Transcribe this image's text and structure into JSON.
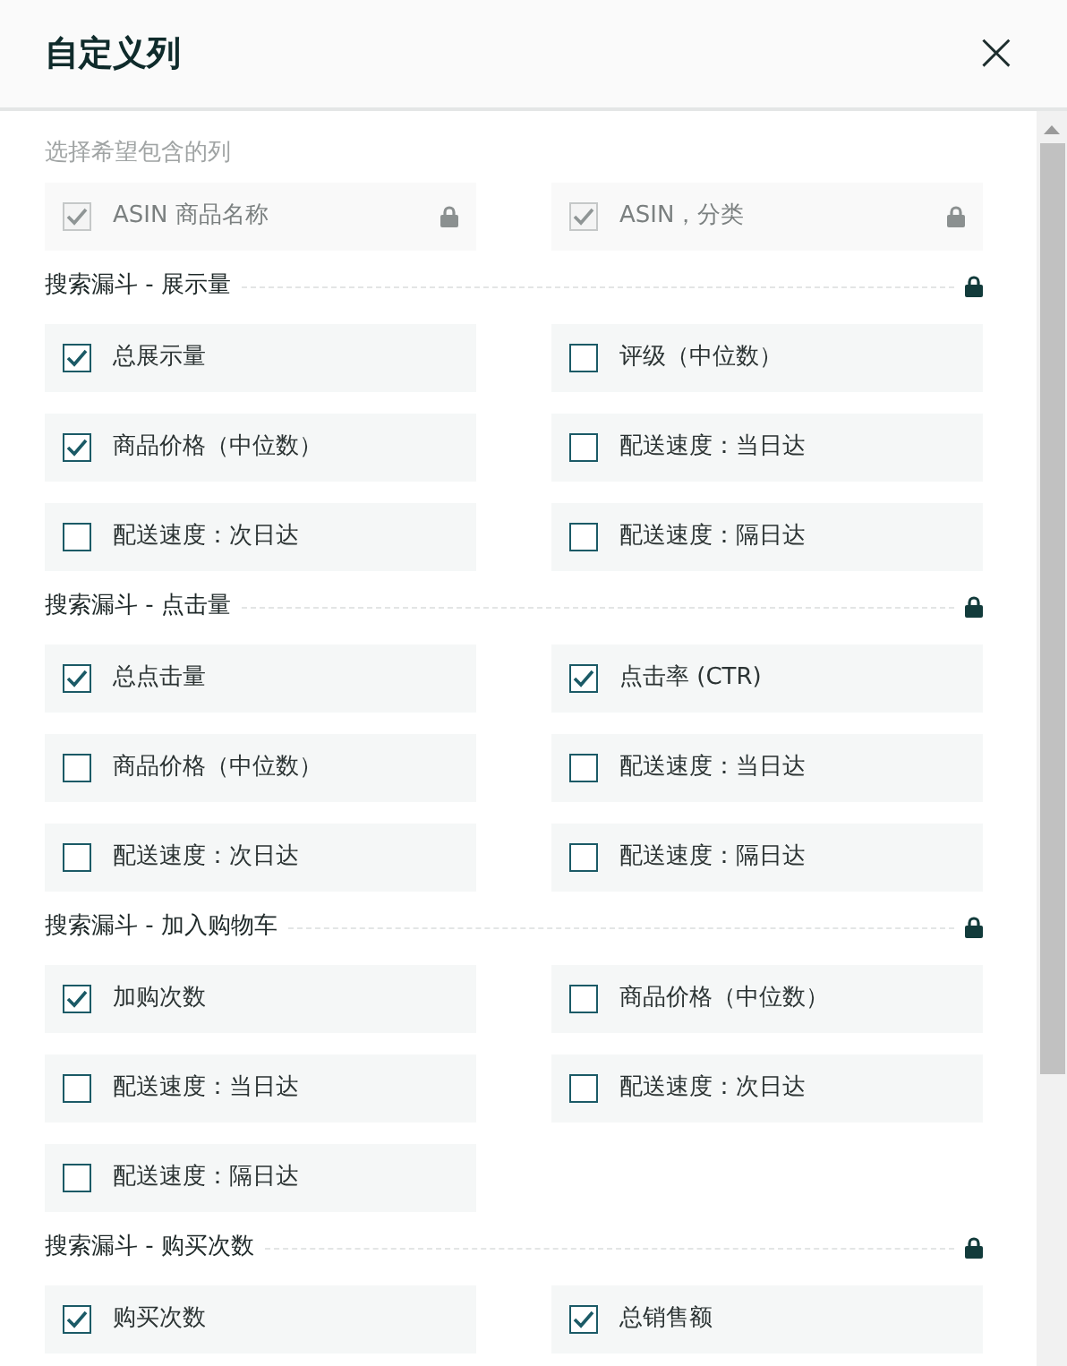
{
  "dialog": {
    "title": "自定义列",
    "close_label": "×"
  },
  "subtitle": "选择希望包含的列",
  "fixed_columns": [
    {
      "label": "ASIN 商品名称",
      "checked": true,
      "disabled": true,
      "locked": true
    },
    {
      "label": "ASIN，分类",
      "checked": true,
      "disabled": true,
      "locked": true
    }
  ],
  "sections": [
    {
      "title": "搜索漏斗 - 展示量",
      "locked": true,
      "options": [
        {
          "label": "总展示量",
          "checked": true
        },
        {
          "label": "评级（中位数）",
          "checked": false
        },
        {
          "label": "商品价格（中位数）",
          "checked": true
        },
        {
          "label": "配送速度：当日达",
          "checked": false
        },
        {
          "label": "配送速度：次日达",
          "checked": false
        },
        {
          "label": "配送速度：隔日达",
          "checked": false
        }
      ]
    },
    {
      "title": "搜索漏斗 - 点击量",
      "locked": true,
      "options": [
        {
          "label": "总点击量",
          "checked": true
        },
        {
          "label": "点击率 (CTR)",
          "checked": true
        },
        {
          "label": "商品价格（中位数）",
          "checked": false
        },
        {
          "label": "配送速度：当日达",
          "checked": false
        },
        {
          "label": "配送速度：次日达",
          "checked": false
        },
        {
          "label": "配送速度：隔日达",
          "checked": false
        }
      ]
    },
    {
      "title": "搜索漏斗 - 加入购物车",
      "locked": true,
      "options": [
        {
          "label": "加购次数",
          "checked": true
        },
        {
          "label": "商品价格（中位数）",
          "checked": false
        },
        {
          "label": "配送速度：当日达",
          "checked": false
        },
        {
          "label": "配送速度：次日达",
          "checked": false
        },
        {
          "label": "配送速度：隔日达",
          "checked": false
        }
      ]
    },
    {
      "title": "搜索漏斗 - 购买次数",
      "locked": true,
      "options": [
        {
          "label": "购买次数",
          "checked": true
        },
        {
          "label": "总销售额",
          "checked": true
        }
      ]
    }
  ]
}
